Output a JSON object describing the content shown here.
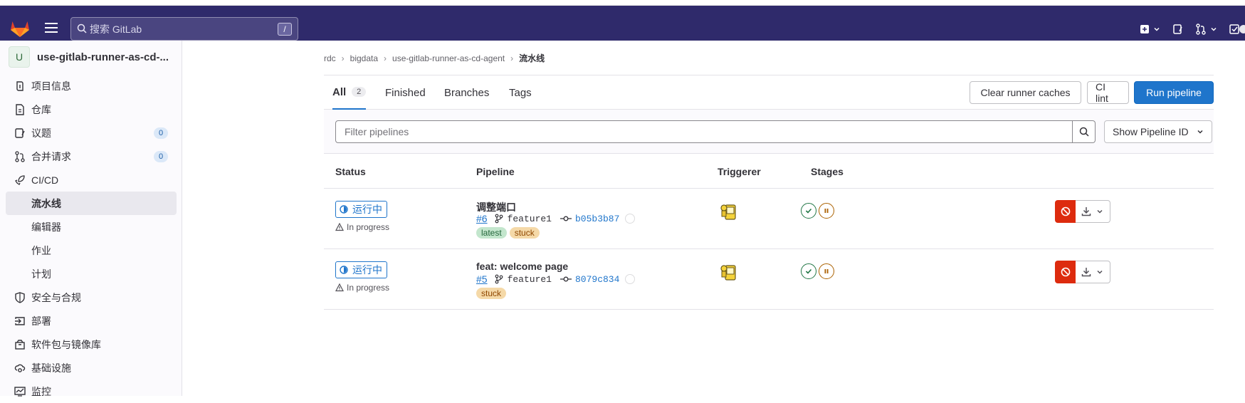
{
  "search": {
    "placeholder": "搜索 GitLab",
    "shortcut": "/"
  },
  "project": {
    "avatar": "U",
    "name": "use-gitlab-runner-as-cd-..."
  },
  "sidebar": {
    "items": [
      {
        "label": "项目信息",
        "icon": "info-icon"
      },
      {
        "label": "仓库",
        "icon": "document-icon"
      },
      {
        "label": "议题",
        "icon": "issues-icon",
        "count": "0"
      },
      {
        "label": "合并请求",
        "icon": "merge-request-icon",
        "count": "0"
      },
      {
        "label": "CI/CD",
        "icon": "rocket-icon"
      },
      {
        "label": "流水线"
      },
      {
        "label": "编辑器"
      },
      {
        "label": "作业"
      },
      {
        "label": "计划"
      },
      {
        "label": "安全与合规",
        "icon": "shield-icon"
      },
      {
        "label": "部署",
        "icon": "deployments-icon"
      },
      {
        "label": "软件包与镜像库",
        "icon": "package-icon"
      },
      {
        "label": "基础设施",
        "icon": "cloud-gear-icon"
      },
      {
        "label": "监控",
        "icon": "monitor-icon"
      }
    ]
  },
  "breadcrumb": [
    "rdc",
    "bigdata",
    "use-gitlab-runner-as-cd-agent",
    "流水线"
  ],
  "tabs": [
    {
      "label": "All",
      "count": "2"
    },
    {
      "label": "Finished"
    },
    {
      "label": "Branches"
    },
    {
      "label": "Tags"
    }
  ],
  "toolbar": {
    "clear_caches": "Clear runner caches",
    "ci_lint": "CI lint",
    "run_pipeline": "Run pipeline"
  },
  "filter": {
    "placeholder": "Filter pipelines",
    "show_id": "Show Pipeline ID"
  },
  "table": {
    "headers": [
      "Status",
      "Pipeline",
      "Triggerer",
      "Stages"
    ],
    "rows": [
      {
        "status": "运行中",
        "substatus": "In progress",
        "title": "调整端口",
        "id": "#6",
        "branch": "feature1",
        "sha": "b05b3b87",
        "labels": [
          "latest",
          "stuck"
        ]
      },
      {
        "status": "运行中",
        "substatus": "In progress",
        "title": "feat: welcome page",
        "id": "#5",
        "branch": "feature1",
        "sha": "8079c834",
        "labels": [
          "stuck"
        ]
      }
    ]
  },
  "colors": {
    "topbar": "#2f2a6b",
    "primary": "#1f75cb",
    "danger": "#dd2b0e"
  }
}
